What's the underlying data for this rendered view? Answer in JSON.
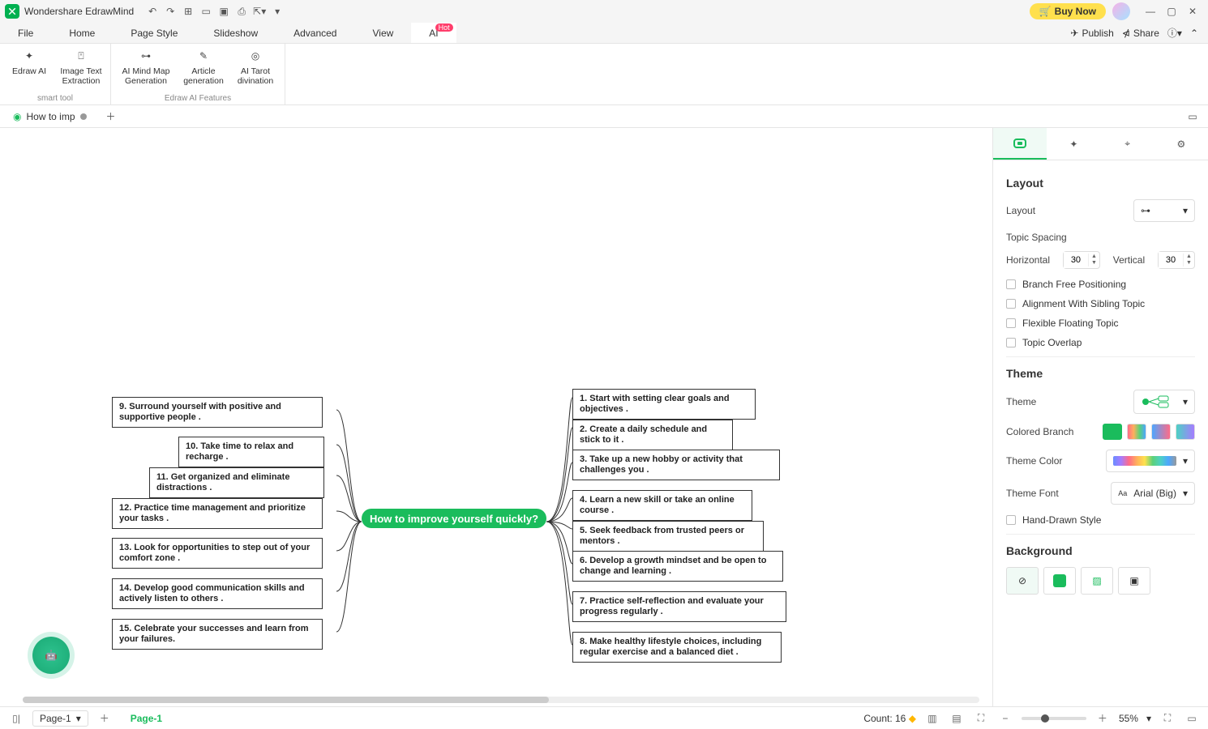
{
  "app": {
    "name": "Wondershare EdrawMind"
  },
  "titlebar": {
    "buy_now": "Buy Now"
  },
  "menus": [
    "File",
    "Home",
    "Page Style",
    "Slideshow",
    "Advanced",
    "View",
    "AI"
  ],
  "menu_hot_badge": "Hot",
  "menubar_right": {
    "publish": "Publish",
    "share": "Share"
  },
  "ribbon": {
    "group1_label": "smart tool",
    "group2_label": "Edraw AI Features",
    "tools1": [
      "Edraw AI",
      "Image Text Extraction"
    ],
    "tools2": [
      "AI Mind Map Generation",
      "Article generation",
      "AI Tarot divination"
    ]
  },
  "doc_tab": "How to imp",
  "mindmap": {
    "central": "How to improve yourself quickly?",
    "right": [
      "1. Start with setting clear goals and objectives .",
      "2. Create a daily schedule and stick to it .",
      "3. Take up a new hobby or activity that challenges you .",
      "4. Learn a new skill or take an online course .",
      "5. Seek feedback from trusted peers or mentors .",
      "6. Develop a growth mindset and be open to change and learning .",
      "7. Practice self-reflection and evaluate your progress regularly .",
      "8. Make healthy lifestyle choices, including regular exercise and a balanced diet ."
    ],
    "left": [
      "9. Surround yourself with positive and supportive people .",
      "10. Take time to relax and recharge .",
      "11. Get organized and eliminate distractions .",
      "12. Practice time management and prioritize your tasks .",
      "13. Look for opportunities to step out of your comfort zone .",
      "14. Develop good communication skills and actively listen to others .",
      "15. Celebrate your successes and learn from your failures."
    ]
  },
  "sidepanel": {
    "section_layout": "Layout",
    "layout_label": "Layout",
    "topic_spacing": "Topic Spacing",
    "horizontal": "Horizontal",
    "vertical": "Vertical",
    "h_val": "30",
    "v_val": "30",
    "check_branch_free": "Branch Free Positioning",
    "check_align_sibling": "Alignment With Sibling Topic",
    "check_flex_float": "Flexible Floating Topic",
    "check_overlap": "Topic Overlap",
    "section_theme": "Theme",
    "theme_label": "Theme",
    "colored_branch": "Colored Branch",
    "theme_color": "Theme Color",
    "theme_font": "Theme Font",
    "theme_font_val": "Arial (Big)",
    "check_handdrawn": "Hand-Drawn Style",
    "section_background": "Background"
  },
  "statusbar": {
    "page_select": "Page-1",
    "page_tab": "Page-1",
    "count": "Count: 16",
    "zoom": "55%"
  }
}
